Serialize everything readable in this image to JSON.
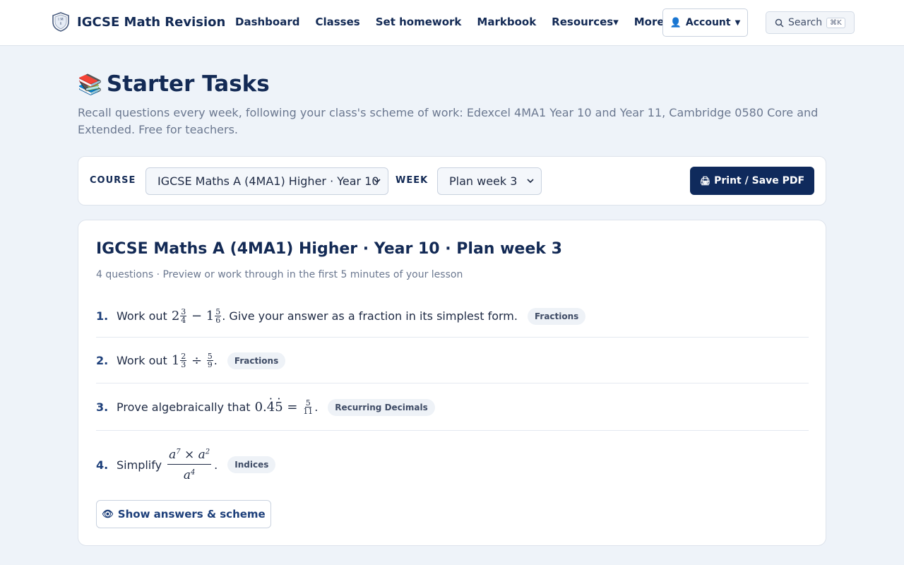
{
  "nav": {
    "brand": "IGCSE Math Revision",
    "links": [
      "Dashboard",
      "Classes",
      "Set homework",
      "Markbook",
      "Resources▾",
      "More▾"
    ],
    "account_label": "Account",
    "account_icon": "user-icon",
    "search_label": "Search",
    "search_kbd": "⌘K"
  },
  "header": {
    "emoji": "📚",
    "title": "Starter Tasks",
    "subtitle": "Recall questions every week, following your class's scheme of work: Edexcel 4MA1 Year 10 and Year 11, Cambridge 0580 Core and Extended. Free for teachers."
  },
  "controls": {
    "course_label": "COURSE",
    "course_value": "IGCSE Maths A (4MA1) Higher · Year 10",
    "week_label": "WEEK",
    "week_value": "Plan week 3",
    "print_label": "Print / Save PDF",
    "print_icon": "🖨"
  },
  "card": {
    "title": "IGCSE Maths A (4MA1) Higher · Year 10 · Plan week 3",
    "meta": "4 questions · Preview or work through in the first 5 minutes of your lesson",
    "questions": [
      {
        "num": "1.",
        "pre": "Work out",
        "post": ". Give your answer as a fraction in its simplest form.",
        "tag": "Fractions"
      },
      {
        "num": "2.",
        "pre": "Work out",
        "post": ".",
        "tag": "Fractions"
      },
      {
        "num": "3.",
        "pre": "Prove algebraically that",
        "post": ".",
        "tag": "Recurring Decimals"
      },
      {
        "num": "4.",
        "pre": "Simplify",
        "post": ".",
        "tag": "Indices"
      }
    ],
    "show_label": "Show answers & scheme",
    "show_icon": "👁"
  },
  "colors": {
    "navy": "#132a55",
    "button_dark": "#0f2a5c",
    "page_bg": "#eef3f9"
  }
}
